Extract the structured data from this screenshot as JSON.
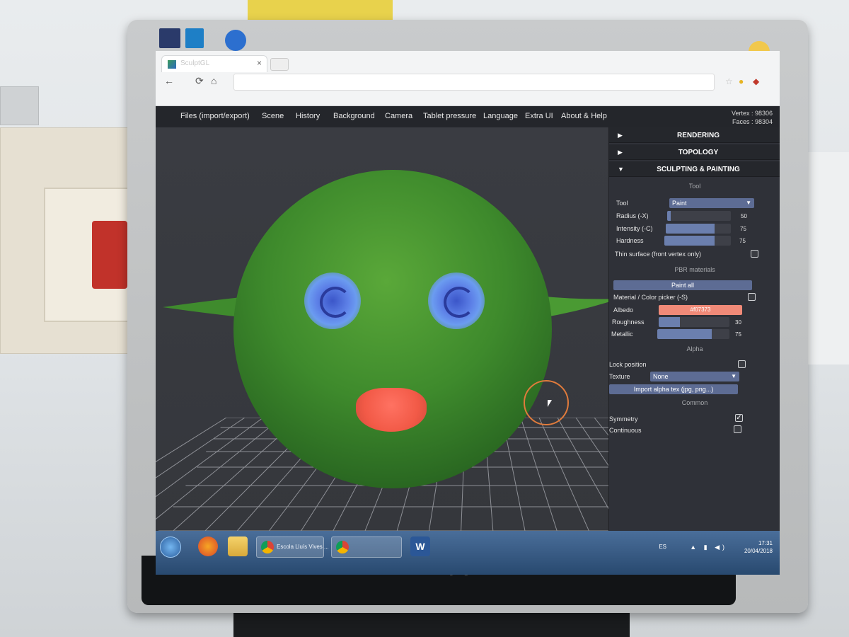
{
  "monitor": {
    "brand": "AOC"
  },
  "browser": {
    "tab_title": "SculptGL",
    "tab_close": "×",
    "back": "←",
    "reload": "⟳",
    "home": "⌂"
  },
  "menu": {
    "items": [
      "Files (import/export)",
      "Scene",
      "History",
      "Background",
      "Camera",
      "Tablet pressure",
      "Language",
      "Extra UI",
      "About & Help"
    ],
    "vertex": "Vertex : 98306",
    "faces": "Faces : 98304"
  },
  "panel": {
    "sections": [
      {
        "arrow": "▶",
        "title": "RENDERING"
      },
      {
        "arrow": "▶",
        "title": "TOPOLOGY"
      },
      {
        "arrow": "▼",
        "title": "SCULPTING & PAINTING"
      }
    ],
    "tool_header": "Tool",
    "tool_label": "Tool",
    "tool_value": "Paint",
    "radius_label": "Radius (-X)",
    "radius_value": "50",
    "radius_fraction": 0.05,
    "intensity_label": "Intensity (-C)",
    "intensity_value": "75",
    "intensity_fraction": 0.75,
    "hardness_label": "Hardness",
    "hardness_value": "75",
    "hardness_fraction": 0.75,
    "thin_surface_label": "Thin surface (front vertex only)",
    "pbr_header": "PBR materials",
    "paint_all": "Paint all",
    "material_picker_label": "Material / Color picker (-S)",
    "albedo_label": "Albedo",
    "albedo_value": "#f07373",
    "albedo_color": "#f08a78",
    "roughness_label": "Roughness",
    "roughness_value": "30",
    "roughness_fraction": 0.3,
    "metallic_label": "Metallic",
    "metallic_value": "75",
    "metallic_fraction": 0.75,
    "alpha_header": "Alpha",
    "lock_position_label": "Lock position",
    "texture_label": "Texture",
    "texture_value": "None",
    "import_alpha": "Import alpha tex (jpg, png...)",
    "common_header": "Common",
    "symmetry_label": "Symmetry",
    "symmetry_checked": "✓",
    "continuous_label": "Continuous"
  },
  "taskbar": {
    "chrome_task_label": "Escola Lluís Vives ...",
    "clock_time": "17:31",
    "clock_date": "20/04/2018",
    "lang": "ES"
  },
  "colors": {
    "head": "#3e8a2c",
    "eyes": "#5e82e8",
    "mouth": "#f25a47",
    "cursor_ring": "#e07b3c"
  }
}
